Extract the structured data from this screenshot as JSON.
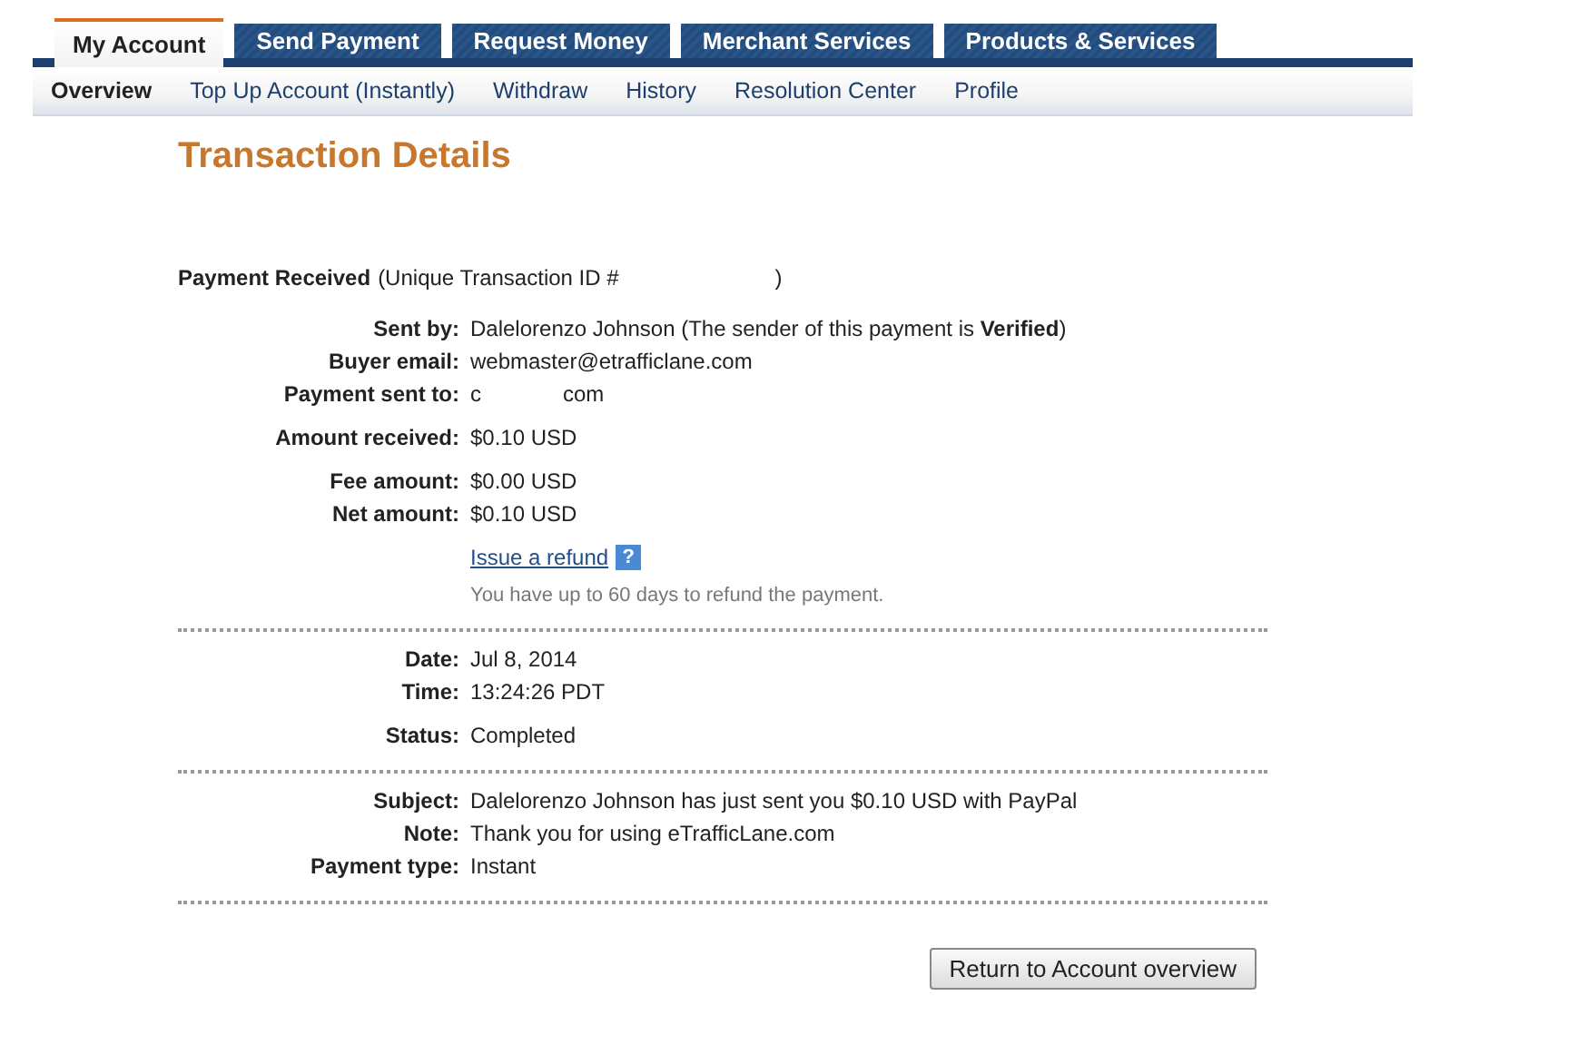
{
  "tabs": [
    {
      "label": "My Account",
      "selected": true
    },
    {
      "label": "Send Payment",
      "selected": false
    },
    {
      "label": "Request Money",
      "selected": false
    },
    {
      "label": "Merchant Services",
      "selected": false
    },
    {
      "label": "Products & Services",
      "selected": false
    }
  ],
  "subnav": [
    {
      "label": "Overview",
      "selected": true
    },
    {
      "label": "Top Up Account (Instantly)",
      "selected": false
    },
    {
      "label": "Withdraw",
      "selected": false
    },
    {
      "label": "History",
      "selected": false
    },
    {
      "label": "Resolution Center",
      "selected": false
    },
    {
      "label": "Profile",
      "selected": false
    }
  ],
  "title": "Transaction Details",
  "header": {
    "lead": "Payment Received",
    "text": "(Unique Transaction ID #",
    "close": ")"
  },
  "sections": [
    {
      "groups": [
        [
          {
            "label": "Sent by:",
            "value": "Dalelorenzo Johnson (The sender of this payment is **Verified**)"
          },
          {
            "label": "Buyer email:",
            "value": "webmaster@etrafficlane.com"
          },
          {
            "label": "Payment sent to:",
            "value": "c",
            "value_end": "com"
          }
        ],
        [
          {
            "label": "Amount received:",
            "value": "$0.10 USD"
          }
        ],
        [
          {
            "label": "Fee amount:",
            "value": "$0.00 USD"
          },
          {
            "label": "Net amount:",
            "value": "$0.10 USD"
          }
        ]
      ],
      "refund": {
        "link": "Issue a refund",
        "help": "?",
        "note": "You have up to 60 days to refund the payment."
      }
    },
    {
      "groups": [
        [
          {
            "label": "Date:",
            "value": "Jul 8, 2014"
          },
          {
            "label": "Time:",
            "value": "13:24:26 PDT"
          }
        ],
        [
          {
            "label": "Status:",
            "value": "Completed"
          }
        ]
      ]
    },
    {
      "groups": [
        [
          {
            "label": "Subject:",
            "value": "Dalelorenzo Johnson has just sent you $0.10 USD with PayPal"
          },
          {
            "label": "Note:",
            "value": "Thank you for using eTrafficLane.com"
          },
          {
            "label": "Payment type:",
            "value": "Instant"
          }
        ]
      ]
    }
  ],
  "button": "Return to Account overview"
}
